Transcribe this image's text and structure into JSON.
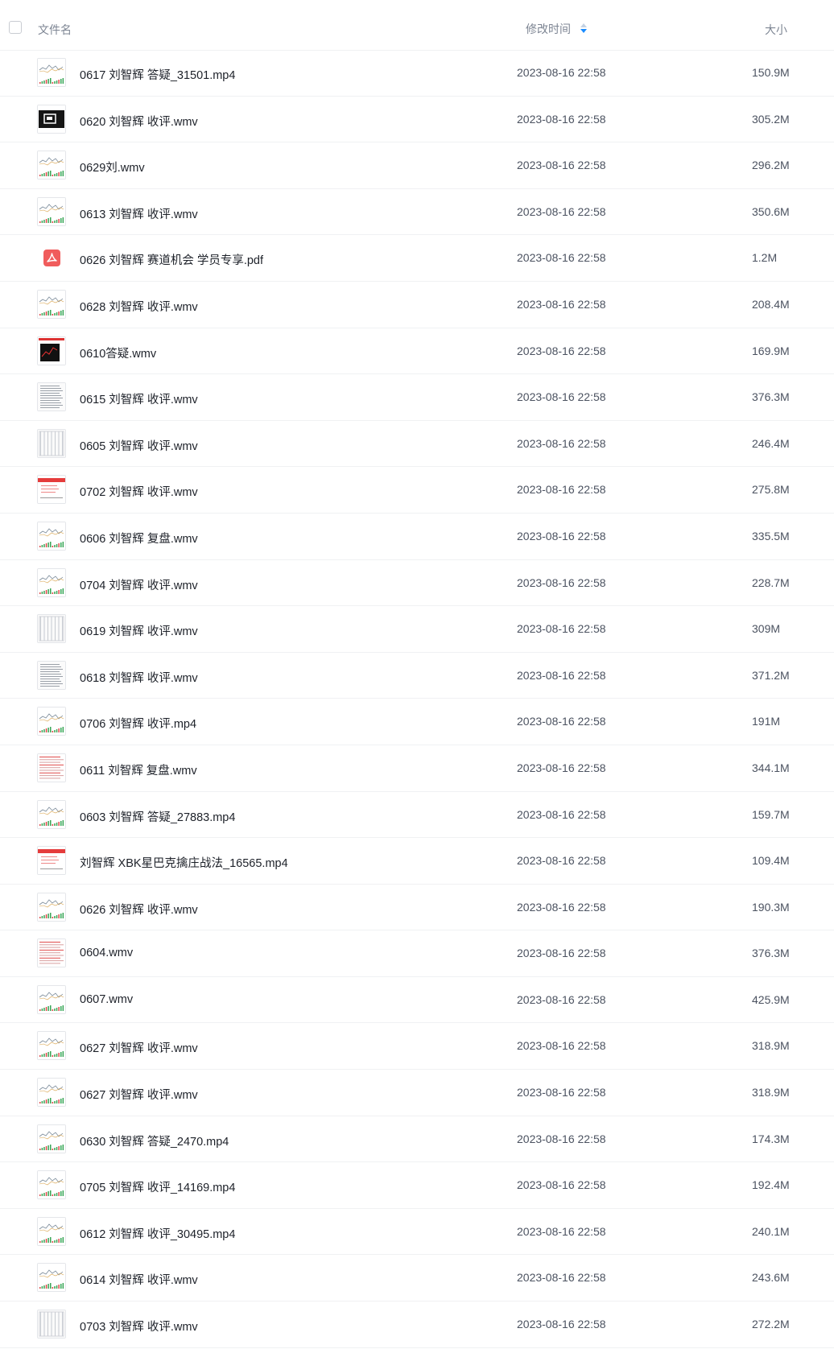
{
  "header": {
    "name_label": "文件名",
    "time_label": "修改时间",
    "size_label": "大小",
    "sort_icon": "sort-icon",
    "select_all_icon": "checkbox-icon"
  },
  "colors": {
    "accent": "#1a8cff",
    "text_primary": "#1d2129",
    "text_secondary": "#4b5260",
    "header_text": "#7d8593",
    "pdf_red": "#f05c5c",
    "divider": "#f0f1f3"
  },
  "files": [
    {
      "name": "0617 刘智辉 答疑_31501.mp4",
      "time": "2023-08-16 22:58",
      "size": "150.9M",
      "thumb": "chart",
      "icon": "video-thumbnail"
    },
    {
      "name": "0620 刘智辉 收评.wmv",
      "time": "2023-08-16 22:58",
      "size": "305.2M",
      "thumb": "dark",
      "icon": "video-thumbnail"
    },
    {
      "name": "0629刘.wmv",
      "time": "2023-08-16 22:58",
      "size": "296.2M",
      "thumb": "chart",
      "icon": "video-thumbnail"
    },
    {
      "name": "0613 刘智辉 收评.wmv",
      "time": "2023-08-16 22:58",
      "size": "350.6M",
      "thumb": "chart",
      "icon": "video-thumbnail"
    },
    {
      "name": "0626 刘智辉 赛道机会 学员专享.pdf",
      "time": "2023-08-16 22:58",
      "size": "1.2M",
      "thumb": "pdf",
      "icon": "pdf-icon"
    },
    {
      "name": "0628 刘智辉 收评.wmv",
      "time": "2023-08-16 22:58",
      "size": "208.4M",
      "thumb": "chart",
      "icon": "video-thumbnail"
    },
    {
      "name": "0610答疑.wmv",
      "time": "2023-08-16 22:58",
      "size": "169.9M",
      "thumb": "darkchart",
      "icon": "video-thumbnail"
    },
    {
      "name": "0615 刘智辉 收评.wmv",
      "time": "2023-08-16 22:58",
      "size": "376.3M",
      "thumb": "text",
      "icon": "video-thumbnail"
    },
    {
      "name": "0605 刘智辉 收评.wmv",
      "time": "2023-08-16 22:58",
      "size": "246.4M",
      "thumb": "table",
      "icon": "video-thumbnail"
    },
    {
      "name": "0702 刘智辉 收评.wmv",
      "time": "2023-08-16 22:58",
      "size": "275.8M",
      "thumb": "redhead",
      "icon": "video-thumbnail"
    },
    {
      "name": "0606 刘智辉 复盘.wmv",
      "time": "2023-08-16 22:58",
      "size": "335.5M",
      "thumb": "chart",
      "icon": "video-thumbnail"
    },
    {
      "name": "0704 刘智辉 收评.wmv",
      "time": "2023-08-16 22:58",
      "size": "228.7M",
      "thumb": "chart",
      "icon": "video-thumbnail"
    },
    {
      "name": "0619 刘智辉 收评.wmv",
      "time": "2023-08-16 22:58",
      "size": "309M",
      "thumb": "table",
      "icon": "video-thumbnail"
    },
    {
      "name": "0618 刘智辉 收评.wmv",
      "time": "2023-08-16 22:58",
      "size": "371.2M",
      "thumb": "text",
      "icon": "video-thumbnail"
    },
    {
      "name": "0706 刘智辉 收评.mp4",
      "time": "2023-08-16 22:58",
      "size": "191M",
      "thumb": "chart",
      "icon": "video-thumbnail"
    },
    {
      "name": "0611 刘智辉 复盘.wmv",
      "time": "2023-08-16 22:58",
      "size": "344.1M",
      "thumb": "redtext",
      "icon": "video-thumbnail"
    },
    {
      "name": "0603 刘智辉 答疑_27883.mp4",
      "time": "2023-08-16 22:58",
      "size": "159.7M",
      "thumb": "chart",
      "icon": "video-thumbnail"
    },
    {
      "name": "刘智辉 XBK星巴克擒庄战法_16565.mp4",
      "time": "2023-08-16 22:58",
      "size": "109.4M",
      "thumb": "redhead",
      "icon": "video-thumbnail"
    },
    {
      "name": "0626 刘智辉 收评.wmv",
      "time": "2023-08-16 22:58",
      "size": "190.3M",
      "thumb": "chart",
      "icon": "video-thumbnail"
    },
    {
      "name": "0604.wmv",
      "time": "2023-08-16 22:58",
      "size": "376.3M",
      "thumb": "redtext",
      "icon": "video-thumbnail"
    },
    {
      "name": "0607.wmv",
      "time": "2023-08-16 22:58",
      "size": "425.9M",
      "thumb": "chart",
      "icon": "video-thumbnail"
    },
    {
      "name": "0627 刘智辉 收评.wmv",
      "time": "2023-08-16 22:58",
      "size": "318.9M",
      "thumb": "chart",
      "icon": "video-thumbnail"
    },
    {
      "name": "0627 刘智辉 收评.wmv",
      "time": "2023-08-16 22:58",
      "size": "318.9M",
      "thumb": "chart",
      "icon": "video-thumbnail"
    },
    {
      "name": "0630 刘智辉 答疑_2470.mp4",
      "time": "2023-08-16 22:58",
      "size": "174.3M",
      "thumb": "chart",
      "icon": "video-thumbnail"
    },
    {
      "name": "0705 刘智辉 收评_14169.mp4",
      "time": "2023-08-16 22:58",
      "size": "192.4M",
      "thumb": "chart",
      "icon": "video-thumbnail"
    },
    {
      "name": "0612 刘智辉 收评_30495.mp4",
      "time": "2023-08-16 22:58",
      "size": "240.1M",
      "thumb": "chart",
      "icon": "video-thumbnail"
    },
    {
      "name": "0614 刘智辉 收评.wmv",
      "time": "2023-08-16 22:58",
      "size": "243.6M",
      "thumb": "chart",
      "icon": "video-thumbnail"
    },
    {
      "name": "0703 刘智辉 收评.wmv",
      "time": "2023-08-16 22:58",
      "size": "272.2M",
      "thumb": "table",
      "icon": "video-thumbnail"
    }
  ]
}
